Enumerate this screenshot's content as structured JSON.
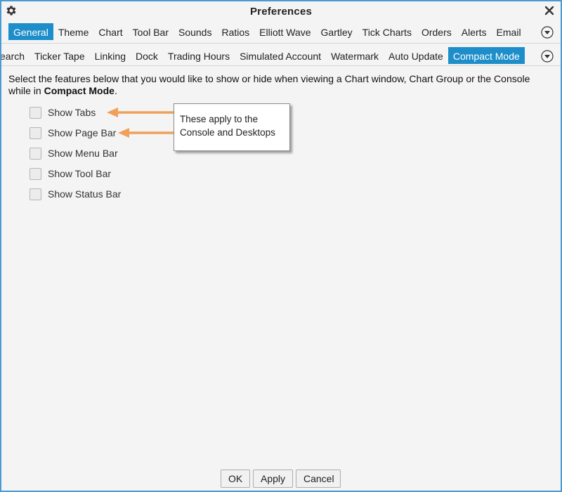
{
  "window": {
    "title": "Preferences"
  },
  "tabs_row1": [
    {
      "label": "General",
      "active": true
    },
    {
      "label": "Theme"
    },
    {
      "label": "Chart"
    },
    {
      "label": "Tool Bar"
    },
    {
      "label": "Sounds"
    },
    {
      "label": "Ratios"
    },
    {
      "label": "Elliott Wave"
    },
    {
      "label": "Gartley"
    },
    {
      "label": "Tick Charts"
    },
    {
      "label": "Orders"
    },
    {
      "label": "Alerts"
    },
    {
      "label": "Email"
    }
  ],
  "tabs_row2": [
    {
      "label": "earch"
    },
    {
      "label": "Ticker Tape"
    },
    {
      "label": "Linking"
    },
    {
      "label": "Dock"
    },
    {
      "label": "Trading Hours"
    },
    {
      "label": "Simulated Account"
    },
    {
      "label": "Watermark"
    },
    {
      "label": "Auto Update"
    },
    {
      "label": "Compact Mode",
      "active": true
    }
  ],
  "description": {
    "text": "Select the features below that you would like to show or hide when viewing a Chart window, Chart Group or the Console while in ",
    "bold": "Compact Mode",
    "end": "."
  },
  "options": [
    {
      "label": "Show Tabs",
      "checked": false
    },
    {
      "label": "Show Page Bar",
      "checked": false
    },
    {
      "label": "Show Menu Bar",
      "checked": false
    },
    {
      "label": "Show Tool Bar",
      "checked": false
    },
    {
      "label": "Show Status Bar",
      "checked": false
    }
  ],
  "callout": {
    "line1": "These apply to the",
    "line2": "Console and Desktops"
  },
  "buttons": {
    "ok": "OK",
    "apply": "Apply",
    "cancel": "Cancel"
  },
  "colors": {
    "accent": "#1d8ec9",
    "arrow": "#f0a05a",
    "border": "#4a9ad4"
  }
}
